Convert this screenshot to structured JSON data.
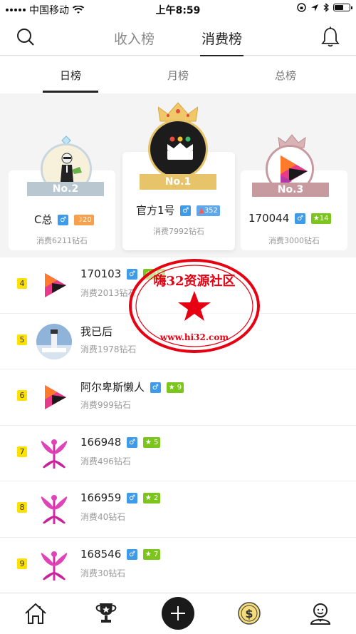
{
  "status_bar": {
    "carrier": "中国移动",
    "time": "上午8:59",
    "icons": [
      "signal-dots-icon",
      "wifi-icon",
      "lock-rotation-icon",
      "location-arrow-icon",
      "bluetooth-icon",
      "battery-icon"
    ]
  },
  "top_nav": {
    "tabs": [
      {
        "label": "收入榜",
        "active": false
      },
      {
        "label": "消费榜",
        "active": true
      }
    ],
    "icons": [
      "search-icon",
      "bell-icon"
    ]
  },
  "sub_tabs": [
    {
      "label": "日榜",
      "active": true
    },
    {
      "label": "月榜",
      "active": false
    },
    {
      "label": "总榜",
      "active": false
    }
  ],
  "podium": [
    {
      "rank_label": "No.2",
      "name": "C总",
      "gender": "♂",
      "level_icon": "moon-icon",
      "level": "20",
      "spent": "消费6211钻石",
      "level_color": "#f6a04d"
    },
    {
      "rank_label": "No.1",
      "name": "官方1号",
      "gender": "♂",
      "level_icon": "crown-icon",
      "level": "352",
      "spent": "消费7992钻石",
      "level_color": "#5fa8ee"
    },
    {
      "rank_label": "No.3",
      "name": "170044",
      "gender": "♂",
      "level_icon": "star-icon",
      "level": "14",
      "spent": "消费3000钻石",
      "level_color": "#7cc51d"
    }
  ],
  "list": [
    {
      "rank": "4",
      "name": "170103",
      "gender": "♂",
      "level": "12",
      "spent": "消费2013钻石",
      "avatar": "play-logo"
    },
    {
      "rank": "5",
      "name": "我已后",
      "gender": "",
      "level": "",
      "spent": "消费1978钻石",
      "avatar": "lighthouse-photo"
    },
    {
      "rank": "6",
      "name": "阿尔卑斯懒人",
      "gender": "♂",
      "level": "9",
      "spent": "消费999钻石",
      "avatar": "play-logo"
    },
    {
      "rank": "7",
      "name": "166948",
      "gender": "♂",
      "level": "5",
      "spent": "消费496钻石",
      "avatar": "flower-logo"
    },
    {
      "rank": "8",
      "name": "166959",
      "gender": "♂",
      "level": "2",
      "spent": "消费40钻石",
      "avatar": "flower-logo"
    },
    {
      "rank": "9",
      "name": "168546",
      "gender": "♂",
      "level": "7",
      "spent": "消费30钻石",
      "avatar": "flower-logo"
    }
  ],
  "watermark": {
    "title": "嗨32资源社区",
    "url": "www.hi32.com"
  },
  "tab_bar": [
    "home-icon",
    "trophy-icon",
    "add-icon",
    "coin-icon",
    "profile-icon"
  ],
  "colors": {
    "gold": "#e7c46a",
    "silver": "#b9c7d0",
    "bronze": "#c79a9f",
    "rank_badge": "#ffe100",
    "watermark_red": "#e60012"
  }
}
